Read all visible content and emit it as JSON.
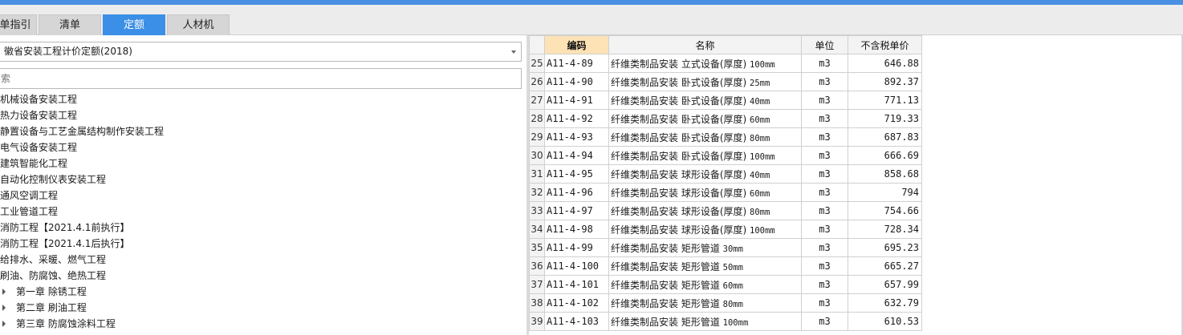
{
  "accent_color": "#3b8fe6",
  "tabs": [
    {
      "label": "单指引",
      "active": false
    },
    {
      "label": "清单",
      "active": false
    },
    {
      "label": "定额",
      "active": true
    },
    {
      "label": "人材机",
      "active": false
    }
  ],
  "quota_library": {
    "selected": "徽省安装工程计价定额(2018)"
  },
  "search": {
    "value": "",
    "placeholder": "索"
  },
  "tree": [
    {
      "label": "机械设备安装工程",
      "indent": false,
      "has_caret": false
    },
    {
      "label": "热力设备安装工程",
      "indent": false,
      "has_caret": false
    },
    {
      "label": "静置设备与工艺金属结构制作安装工程",
      "indent": false,
      "has_caret": false
    },
    {
      "label": "电气设备安装工程",
      "indent": false,
      "has_caret": false
    },
    {
      "label": "建筑智能化工程",
      "indent": false,
      "has_caret": false
    },
    {
      "label": "自动化控制仪表安装工程",
      "indent": false,
      "has_caret": false
    },
    {
      "label": "通风空调工程",
      "indent": false,
      "has_caret": false
    },
    {
      "label": "工业管道工程",
      "indent": false,
      "has_caret": false
    },
    {
      "label": "消防工程【2021.4.1前执行】",
      "indent": false,
      "has_caret": false
    },
    {
      "label": "消防工程【2021.4.1后执行】",
      "indent": false,
      "has_caret": false
    },
    {
      "label": "给排水、采暖、燃气工程",
      "indent": false,
      "has_caret": false
    },
    {
      "label": "刷油、防腐蚀、绝热工程",
      "indent": false,
      "has_caret": false
    },
    {
      "label": "第一章 除锈工程",
      "indent": true,
      "has_caret": true
    },
    {
      "label": "第二章 刷油工程",
      "indent": true,
      "has_caret": true
    },
    {
      "label": "第三章 防腐蚀涂料工程",
      "indent": true,
      "has_caret": true
    }
  ],
  "grid": {
    "headers": {
      "code": "编码",
      "name": "名称",
      "unit": "单位",
      "price": "不含税单价"
    },
    "rows": [
      {
        "idx": "25",
        "code": "A11-4-89",
        "name_cn": "纤维类制品安装 立式设备(厚度)",
        "name_spec": "100mm",
        "unit": "m3",
        "price": "646.88"
      },
      {
        "idx": "26",
        "code": "A11-4-90",
        "name_cn": "纤维类制品安装 卧式设备(厚度)",
        "name_spec": "25mm",
        "unit": "m3",
        "price": "892.37"
      },
      {
        "idx": "27",
        "code": "A11-4-91",
        "name_cn": "纤维类制品安装 卧式设备(厚度)",
        "name_spec": "40mm",
        "unit": "m3",
        "price": "771.13"
      },
      {
        "idx": "28",
        "code": "A11-4-92",
        "name_cn": "纤维类制品安装 卧式设备(厚度)",
        "name_spec": "60mm",
        "unit": "m3",
        "price": "719.33"
      },
      {
        "idx": "29",
        "code": "A11-4-93",
        "name_cn": "纤维类制品安装 卧式设备(厚度)",
        "name_spec": "80mm",
        "unit": "m3",
        "price": "687.83"
      },
      {
        "idx": "30",
        "code": "A11-4-94",
        "name_cn": "纤维类制品安装 卧式设备(厚度)",
        "name_spec": "100mm",
        "unit": "m3",
        "price": "666.69"
      },
      {
        "idx": "31",
        "code": "A11-4-95",
        "name_cn": "纤维类制品安装 球形设备(厚度)",
        "name_spec": "40mm",
        "unit": "m3",
        "price": "858.68"
      },
      {
        "idx": "32",
        "code": "A11-4-96",
        "name_cn": "纤维类制品安装 球形设备(厚度)",
        "name_spec": "60mm",
        "unit": "m3",
        "price": "794"
      },
      {
        "idx": "33",
        "code": "A11-4-97",
        "name_cn": "纤维类制品安装 球形设备(厚度)",
        "name_spec": "80mm",
        "unit": "m3",
        "price": "754.66"
      },
      {
        "idx": "34",
        "code": "A11-4-98",
        "name_cn": "纤维类制品安装 球形设备(厚度)",
        "name_spec": "100mm",
        "unit": "m3",
        "price": "728.34"
      },
      {
        "idx": "35",
        "code": "A11-4-99",
        "name_cn": "纤维类制品安装 矩形管道",
        "name_spec": "30mm",
        "unit": "m3",
        "price": "695.23"
      },
      {
        "idx": "36",
        "code": "A11-4-100",
        "name_cn": "纤维类制品安装 矩形管道",
        "name_spec": "50mm",
        "unit": "m3",
        "price": "665.27"
      },
      {
        "idx": "37",
        "code": "A11-4-101",
        "name_cn": "纤维类制品安装 矩形管道",
        "name_spec": "60mm",
        "unit": "m3",
        "price": "657.99"
      },
      {
        "idx": "38",
        "code": "A11-4-102",
        "name_cn": "纤维类制品安装 矩形管道",
        "name_spec": "80mm",
        "unit": "m3",
        "price": "632.79"
      },
      {
        "idx": "39",
        "code": "A11-4-103",
        "name_cn": "纤维类制品安装 矩形管道",
        "name_spec": "100mm",
        "unit": "m3",
        "price": "610.53"
      }
    ]
  }
}
